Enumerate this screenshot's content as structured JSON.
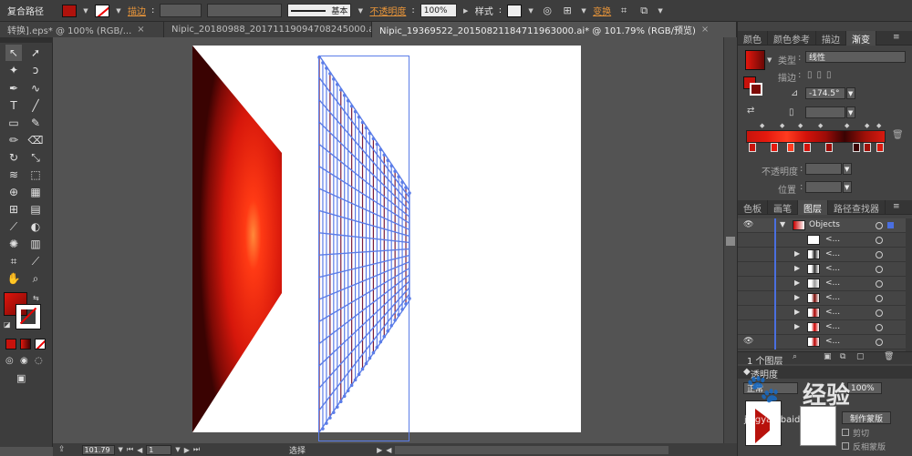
{
  "control_bar": {
    "selection_type": "复合路径",
    "fill_color": "#b0120c",
    "stroke_none": true,
    "stroke_label": "描边",
    "brush_label": "基本",
    "opacity_label": "不透明度",
    "opacity_value": "100%",
    "style_label": "样式",
    "transform_label": "变换"
  },
  "tabs": [
    {
      "label": "转换].eps* @ 100% (RGB/...",
      "active": false
    },
    {
      "label": "Nipic_20180988_20171119094708245000.ai*",
      "active": false
    },
    {
      "label": "Nipic_19369522_20150821184711963000.ai* @ 101.79% (RGB/预览)",
      "active": true
    }
  ],
  "tools": {
    "selection": "selection-arrow-icon",
    "direct_selection": "direct-selection-icon"
  },
  "status_bar": {
    "zoom": "101.79",
    "artboard_number": "1",
    "mode": "选择"
  },
  "gradient_panel": {
    "tabs": [
      "颜色",
      "颜色参考",
      "描边",
      "渐变"
    ],
    "active_tab": "渐变",
    "type_label": "类型",
    "type_value": "线性",
    "stroke_label": "描边",
    "angle_value": "-174.5°",
    "opacity_label": "不透明度",
    "position_label": "位置",
    "stops": [
      "#c8140c",
      "#e4190e",
      "#ff3b1f",
      "#d3120a",
      "#9e0c08",
      "#3a0303",
      "#a01008",
      "#d81a10"
    ]
  },
  "layers_panel": {
    "tabs": [
      "色板",
      "画笔",
      "图层",
      "路径查找器"
    ],
    "active_tab": "图层",
    "top_layer_name": "Objects",
    "sublayer_label": "<...",
    "footer_count": "1 个图层"
  },
  "transparency_panel": {
    "title": "透明度",
    "mode": "正常",
    "opacity_value": "100%",
    "make_mask_button": "制作蒙版",
    "clip_label": "剪切",
    "invert_label": "反相蒙版"
  },
  "watermark": {
    "text": "经验",
    "sub": "jingyan.baidu.com"
  }
}
